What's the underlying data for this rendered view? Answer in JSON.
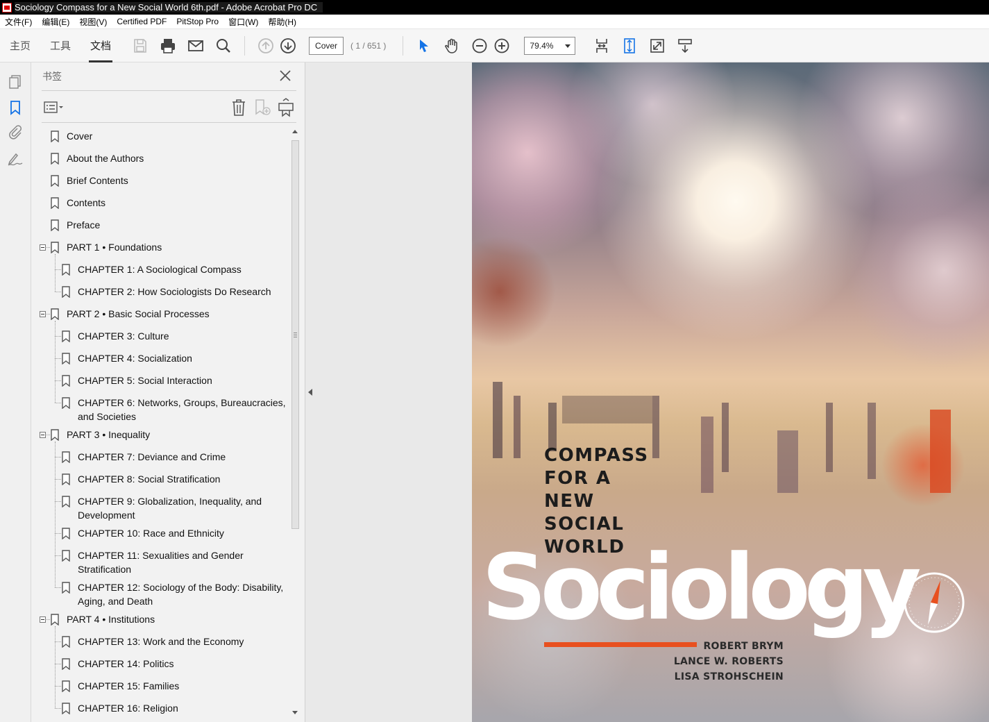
{
  "window": {
    "title": "Sociology Compass for a New Social World 6th.pdf - Adobe Acrobat Pro DC"
  },
  "menubar": {
    "items": [
      "文件(F)",
      "编辑(E)",
      "视图(V)",
      "Certified PDF",
      "PitStop Pro",
      "窗口(W)",
      "帮助(H)"
    ]
  },
  "toolbar": {
    "tabs": [
      "主页",
      "工具",
      "文档"
    ],
    "active_tab": "文档",
    "page_field": "Cover",
    "page_count": "( 1 / 651 )",
    "zoom": "79.4%"
  },
  "bookmarks": {
    "header": "书签",
    "items": [
      {
        "label": "Cover",
        "level": 0
      },
      {
        "label": "About the Authors",
        "level": 0
      },
      {
        "label": "Brief Contents",
        "level": 0
      },
      {
        "label": "Contents",
        "level": 0
      },
      {
        "label": "Preface",
        "level": 0
      },
      {
        "label": "PART 1 • Foundations",
        "level": 0,
        "expanded": true
      },
      {
        "label": "CHAPTER 1: A Sociological Compass",
        "level": 1
      },
      {
        "label": "CHAPTER 2: How Sociologists Do Research",
        "level": 1
      },
      {
        "label": "PART 2 • Basic Social Processes",
        "level": 0,
        "expanded": true
      },
      {
        "label": "CHAPTER 3: Culture",
        "level": 1
      },
      {
        "label": "CHAPTER 4: Socialization",
        "level": 1
      },
      {
        "label": "CHAPTER 5: Social Interaction",
        "level": 1
      },
      {
        "label": "CHAPTER 6: Networks, Groups, Bureaucracies, and Societies",
        "level": 1
      },
      {
        "label": "PART 3 • Inequality",
        "level": 0,
        "expanded": true
      },
      {
        "label": "CHAPTER 7: Deviance and Crime",
        "level": 1
      },
      {
        "label": "CHAPTER 8: Social Stratification",
        "level": 1
      },
      {
        "label": "CHAPTER 9: Globalization, Inequality, and Development",
        "level": 1
      },
      {
        "label": "CHAPTER 10: Race and Ethnicity",
        "level": 1
      },
      {
        "label": "CHAPTER 11: Sexualities and Gender Stratification",
        "level": 1
      },
      {
        "label": "CHAPTER 12: Sociology of the Body: Disability, Aging, and Death",
        "level": 1
      },
      {
        "label": "PART 4 • Institutions",
        "level": 0,
        "expanded": true
      },
      {
        "label": "CHAPTER 13: Work and the Economy",
        "level": 1
      },
      {
        "label": "CHAPTER 14: Politics",
        "level": 1
      },
      {
        "label": "CHAPTER 15: Families",
        "level": 1
      },
      {
        "label": "CHAPTER 16: Religion",
        "level": 1
      }
    ]
  },
  "cover": {
    "subtitle_lines": [
      "COMPASS",
      "FOR A",
      "NEW",
      "SOCIAL",
      "WORLD"
    ],
    "title": "Sociology",
    "authors": [
      "ROBERT BRYM",
      "LANCE W. ROBERTS",
      "LISA STROHSCHEIN"
    ]
  },
  "colors": {
    "accent_orange": "#e8501f",
    "toolbar_bg": "#f6f6f6",
    "panel_bg": "#f2f2f2",
    "acrobat_blue": "#1473e6"
  }
}
